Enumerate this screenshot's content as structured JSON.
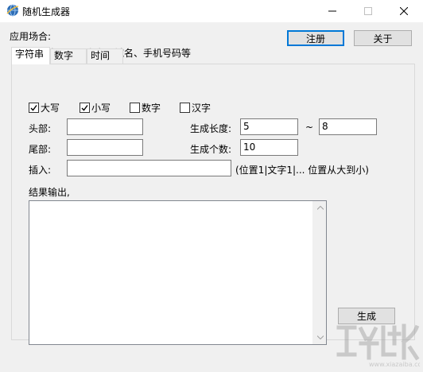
{
  "window": {
    "title": "随机生成器",
    "controls": [
      "minimize-icon",
      "maximize-icon",
      "close-icon"
    ]
  },
  "header": {
    "usage_label": "应用场合:",
    "usage_text": "随机密码、用户名、域名、手机号码等",
    "register_button": "注册",
    "about_button": "关于"
  },
  "tabs": [
    {
      "label": "字符串",
      "active": true
    },
    {
      "label": "数字",
      "active": false
    },
    {
      "label": "时间",
      "active": false
    }
  ],
  "options": [
    {
      "label": "大写",
      "checked": true
    },
    {
      "label": "小写",
      "checked": true
    },
    {
      "label": "数字",
      "checked": false
    },
    {
      "label": "汉字",
      "checked": false
    }
  ],
  "fields": {
    "head_label": "头部:",
    "head_value": "",
    "tail_label": "尾部:",
    "tail_value": "",
    "insert_label": "插入:",
    "insert_value": "",
    "insert_hint": "(位置1|文字1|... 位置从大到小)",
    "length_label": "生成长度:",
    "length_min": "5",
    "length_sep": "~",
    "length_max": "8",
    "count_label": "生成个数:",
    "count_value": "10"
  },
  "result": {
    "label": "结果输出,",
    "content": ""
  },
  "generate_button": "生成",
  "colors": {
    "client_bg": "#f0f0f0",
    "button_bg": "#e1e1e1",
    "focus_border": "#0078d7"
  }
}
